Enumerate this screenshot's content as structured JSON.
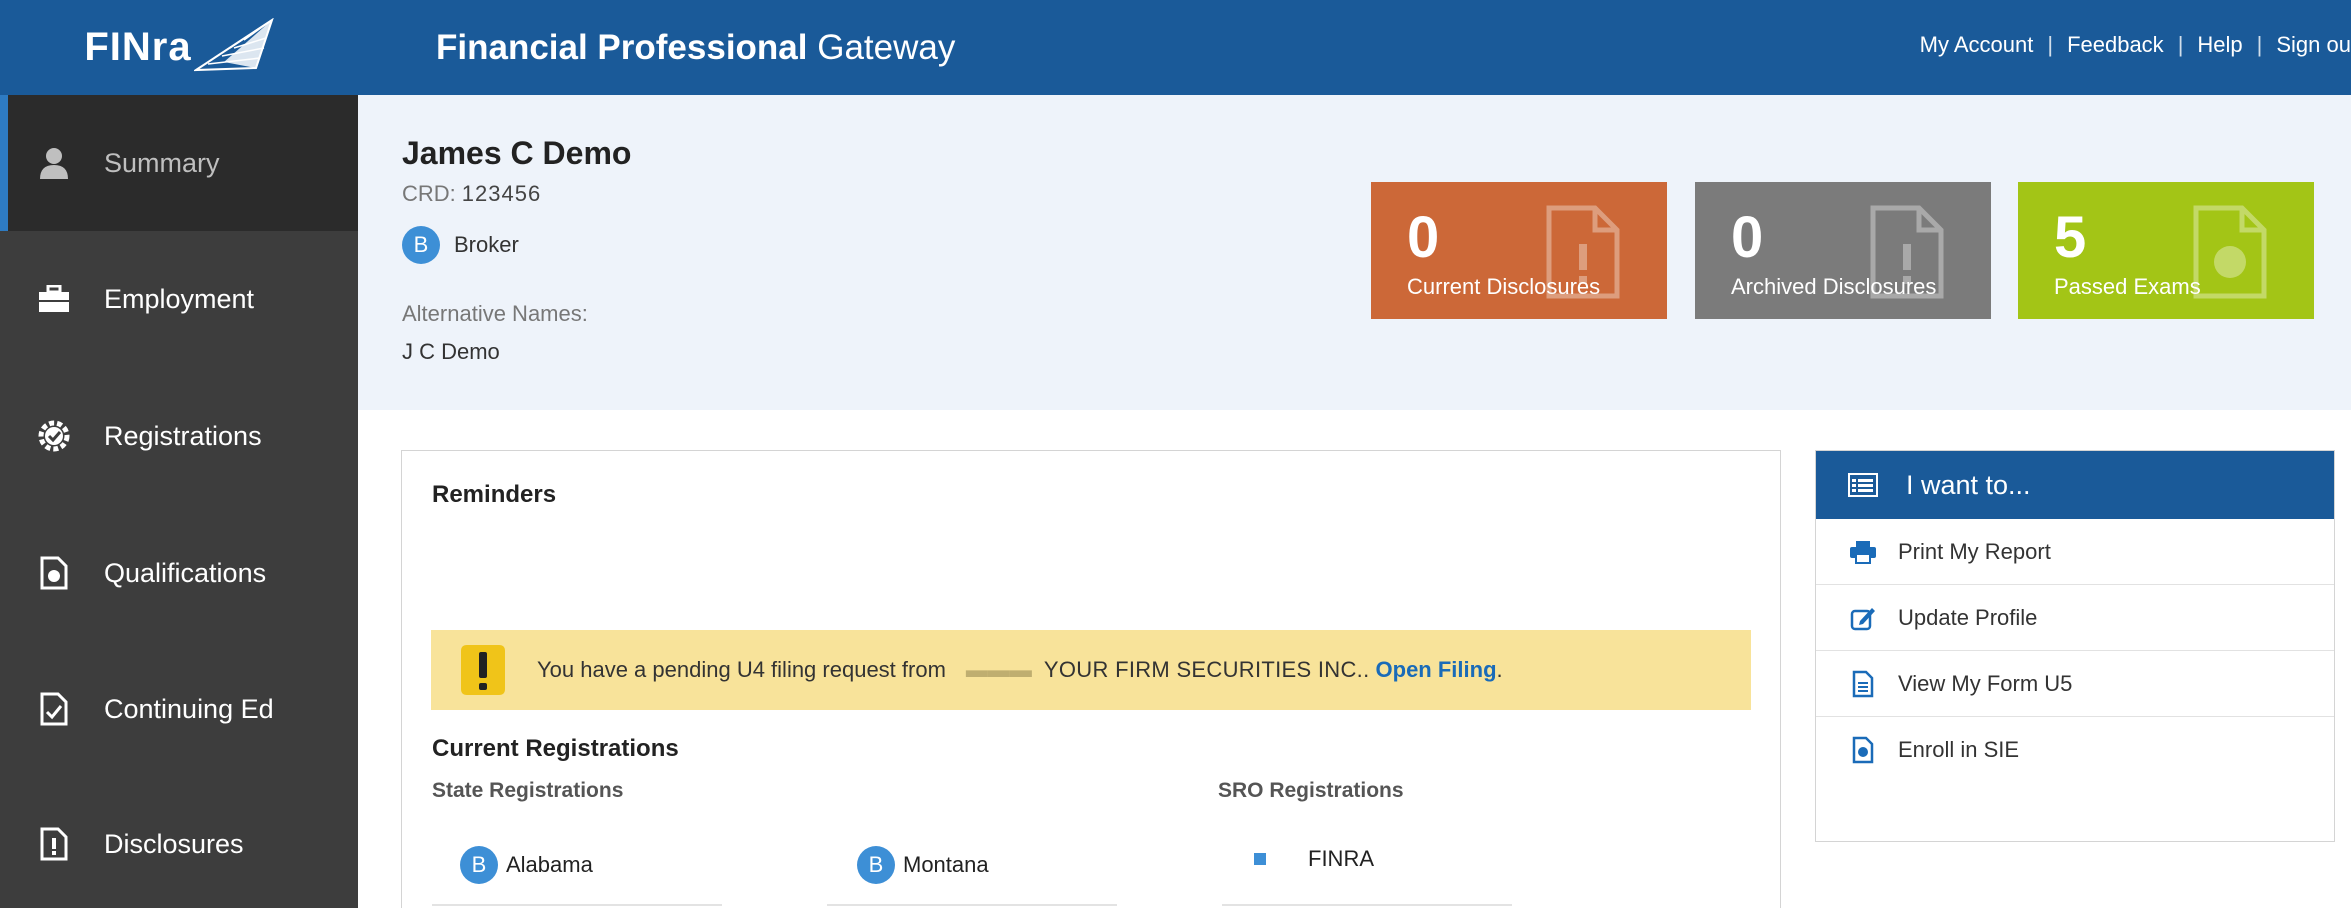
{
  "brand": {
    "logo_text": "FINra"
  },
  "header": {
    "title_bold": "Financial Professional",
    "title_rest": "Gateway",
    "links": [
      "My Account",
      "Feedback",
      "Help",
      "Sign ou"
    ]
  },
  "sidebar": {
    "items": [
      {
        "label": "Summary",
        "icon": "person-icon",
        "active": true
      },
      {
        "label": "Employment",
        "icon": "briefcase-icon"
      },
      {
        "label": "Registrations",
        "icon": "gear-badge-icon"
      },
      {
        "label": "Qualifications",
        "icon": "certificate-doc-icon"
      },
      {
        "label": "Continuing Ed",
        "icon": "checked-doc-icon"
      },
      {
        "label": "Disclosures",
        "icon": "alert-doc-icon"
      }
    ]
  },
  "profile": {
    "name": "James C Demo",
    "crd_label": "CRD:",
    "crd_value": "123456",
    "role_badge": "B",
    "role": "Broker",
    "alt_names_label": "Alternative Names:",
    "alt_names_value": "J C Demo"
  },
  "tiles": [
    {
      "count": "0",
      "label": "Current Disclosures",
      "color": "#cc6838"
    },
    {
      "count": "0",
      "label": "Archived Disclosures",
      "color": "#7b7b7b"
    },
    {
      "count": "5",
      "label": "Passed Exams",
      "color": "#a3c516"
    }
  ],
  "main": {
    "reminders_title": "Reminders",
    "alert": {
      "text": "You have a pending U4 filing request from",
      "firm": "YOUR FIRM SECURITIES INC..",
      "link": "Open Filing",
      "link_suffix": "."
    },
    "current_reg_title": "Current Registrations",
    "state_title": "State Registrations",
    "sro_title": "SRO Registrations",
    "state_regs": [
      {
        "badge": "B",
        "label": "Alabama"
      },
      {
        "badge": "B",
        "label": "Montana"
      }
    ],
    "sro_regs": [
      {
        "label": "FINRA"
      }
    ]
  },
  "want_to": {
    "title": "I want to...",
    "items": [
      {
        "label": "Print My Report",
        "icon": "printer-icon"
      },
      {
        "label": "Update Profile",
        "icon": "edit-icon"
      },
      {
        "label": "View My Form U5",
        "icon": "document-icon"
      },
      {
        "label": "Enroll in SIE",
        "icon": "certificate-doc-icon"
      }
    ]
  },
  "colors": {
    "accent": "#1a5a99",
    "sidebar": "#3d3d3d",
    "badge": "#3d8fd6",
    "alert": "#f8e39a"
  }
}
